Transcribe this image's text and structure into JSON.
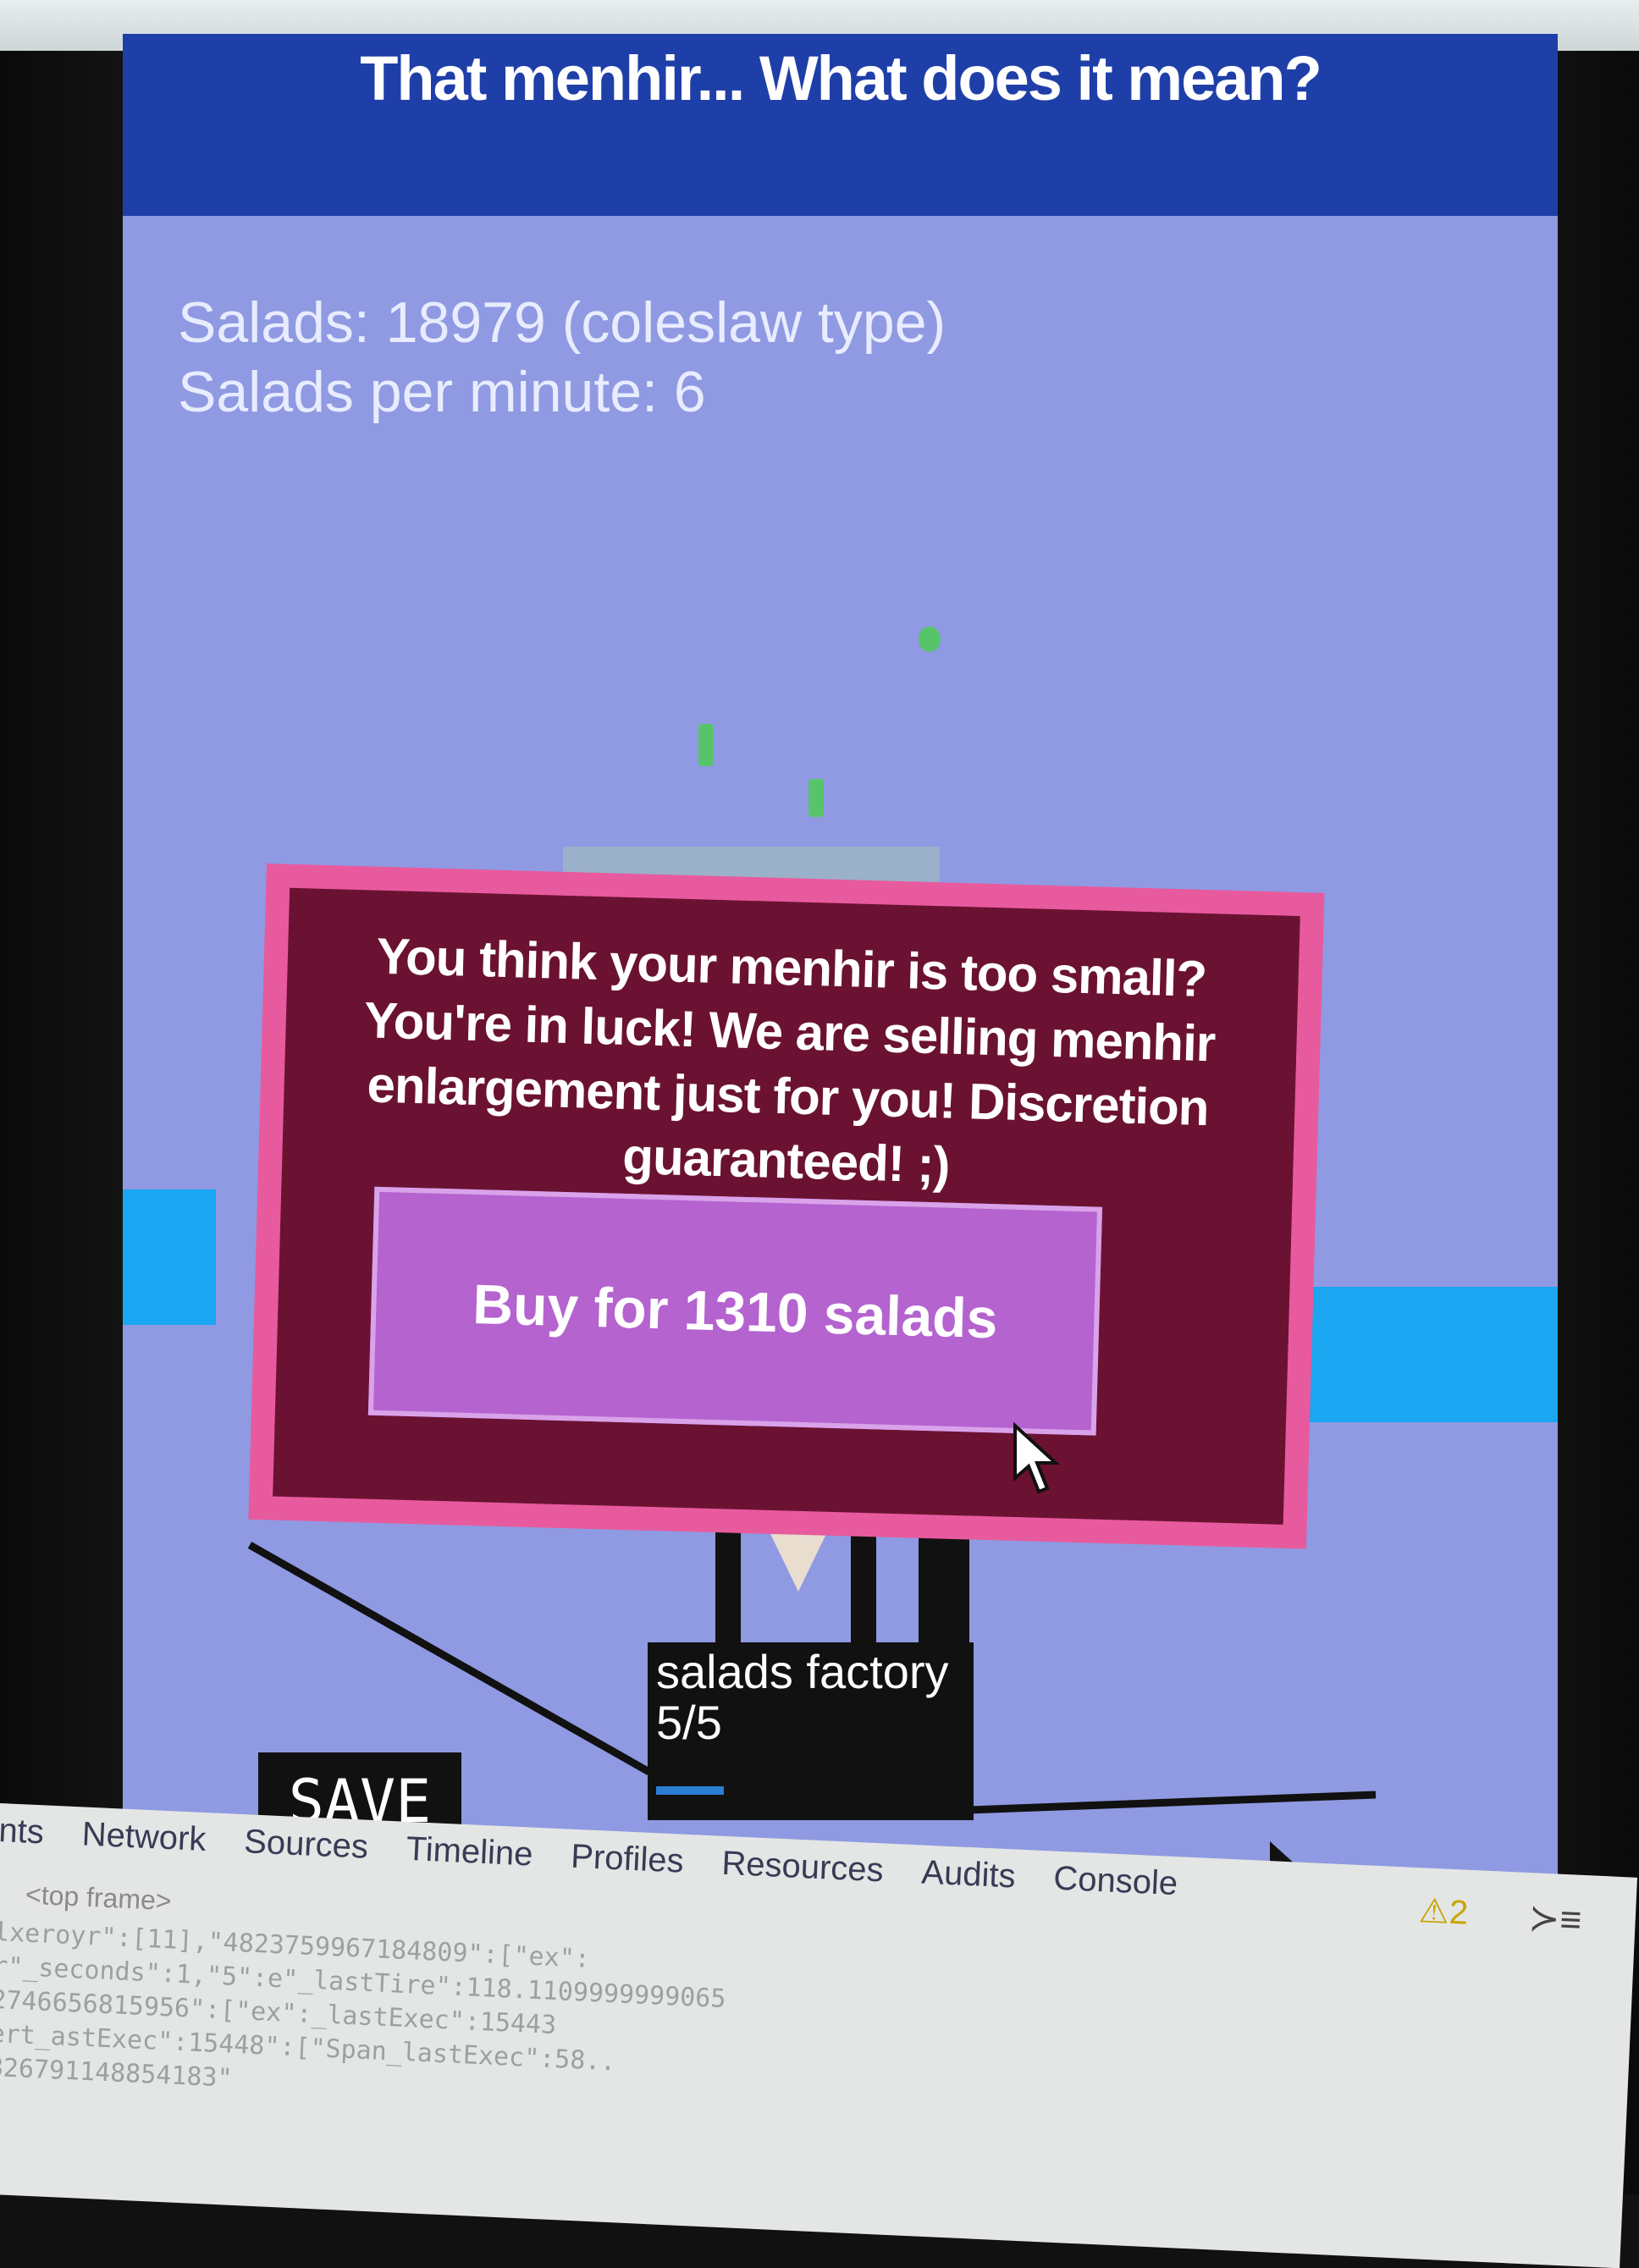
{
  "title": "That menhir... What does it mean?",
  "stats": {
    "salads": "Salads: 18979 (coleslaw type)",
    "salads_per_minute": "Salads per minute: 6"
  },
  "popup": {
    "message": "You think your menhir is too small? You're in luck! We are selling menhir enlargement just for you! Discretion guaranteed! ;)",
    "buy_label": "Buy for 1310 salads"
  },
  "factory": {
    "name": "salads factory",
    "count": "5/5",
    "progress": 0.22
  },
  "save_label": "SAVE",
  "devtools": {
    "tabs": [
      "nts",
      "Network",
      "Sources",
      "Timeline",
      "Profiles",
      "Resources",
      "Audits",
      "Console"
    ],
    "frame": "<top frame>",
    "warning_count": "2",
    "console_lines": [
      "lxeroyr\":[11],\"4823759967184809\":[\"ex\":",
      "r\"_seconds\":1,\"5\":e\"_lastTire\":118.1109999999065",
      "2746656815956\":[\"ex\":_lastExec\":15443",
      "ert_astExec\":15448\":[\"Span_lastExec\":58..",
      "826791148854183\""
    ]
  },
  "colors": {
    "title_bar": "#1f3fa8",
    "game_bg": "#8f9ae2",
    "modal_border": "#e85a9e",
    "modal_bg": "#6b1233",
    "buy_button": "#b463cf"
  }
}
